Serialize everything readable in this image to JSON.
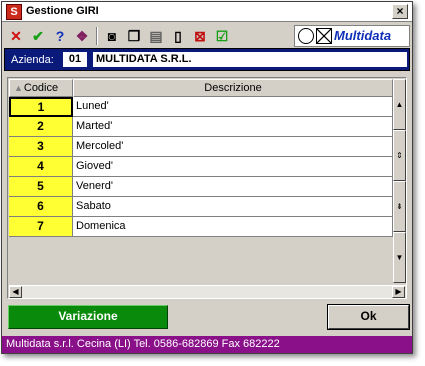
{
  "window": {
    "title": "Gestione GIRI",
    "app_icon": "S",
    "close": "×"
  },
  "toolbar": {
    "buttons": [
      {
        "icon": "delete-x-icon",
        "glyph": "✕"
      },
      {
        "icon": "confirm-check-icon",
        "glyph": "✔"
      },
      {
        "icon": "help-icon",
        "glyph": "?"
      },
      {
        "icon": "book-icon",
        "glyph": "❖"
      },
      {
        "icon": "binoculars-icon",
        "glyph": "◙"
      },
      {
        "icon": "copy-icon",
        "glyph": "❐"
      },
      {
        "icon": "paste-icon",
        "glyph": "▤"
      },
      {
        "icon": "new-document-icon",
        "glyph": "▯"
      },
      {
        "icon": "remove-record-icon",
        "glyph": "⊠"
      },
      {
        "icon": "checkbox-icon",
        "glyph": "☑"
      }
    ],
    "brand": "Multidata",
    "colors": {
      "delete": "#d01010",
      "confirm": "#18a018",
      "help": "#1030b8",
      "brand": "#1030b8"
    }
  },
  "azienda": {
    "label": "Azienda:",
    "code": "01",
    "name": "MULTIDATA S.R.L."
  },
  "grid": {
    "columns": [
      "Codice",
      "Descrizione"
    ],
    "rows": [
      {
        "code": "1",
        "desc": "Luned'"
      },
      {
        "code": "2",
        "desc": "Marted'"
      },
      {
        "code": "3",
        "desc": "Mercoled'"
      },
      {
        "code": "4",
        "desc": "Gioved'"
      },
      {
        "code": "5",
        "desc": "Venerd'"
      },
      {
        "code": "6",
        "desc": "Sabato"
      },
      {
        "code": "7",
        "desc": "Domenica"
      }
    ],
    "code_color": "#ffff33"
  },
  "buttons": {
    "variazione": "Variazione",
    "ok": "Ok"
  },
  "status": "Multidata s.r.l. Cecina (LI) Tel. 0586-682869  Fax 682222"
}
